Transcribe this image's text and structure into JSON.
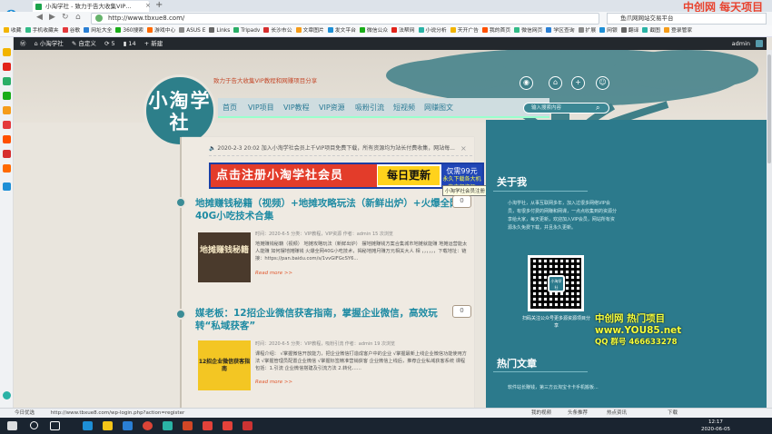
{
  "browser": {
    "tab_title": "小淘学社 - 致力于告大收集VIP…",
    "url": "http://www.tbxue8.com/",
    "search_text": "鱼爪网网站交易平台",
    "top_promo": "中创网  每天项目",
    "bookmarks": [
      "收藏",
      "手机收藏夹",
      "谷歌",
      "网址大全",
      "360搜索",
      "游戏中心",
      "ASUS E",
      "Links",
      "Tripadv",
      "长沙市公",
      "文章图片",
      "发文平台",
      "微信公众",
      "法帮网",
      "小说分析",
      "天开广告",
      "我的首页",
      "微信网页",
      "学区查询",
      "扩展",
      "网银",
      "翻译",
      "截图",
      "登录管家"
    ]
  },
  "wpbar": {
    "items": [
      "小淘学社",
      "自定义",
      "5",
      "14",
      "+ 新建"
    ],
    "user": "admin"
  },
  "site": {
    "logo_text": "小淘学社",
    "tagline": "致力于告大收集VIP教程和网赚项目分享",
    "nav": [
      "首页",
      "VIP项目",
      "VIP教程",
      "VIP资源",
      "吸粉引流",
      "短视频",
      "网赚图文"
    ],
    "search_placeholder": "输入搜索内容"
  },
  "announcement": "2020-2-3  20:02  加入小淘学社会员上千VIP项目免费下载，所有资源均为站长付费收集，网站每...",
  "banner": {
    "red": "点击注册小淘学社会员",
    "yellow": "每日更新",
    "blue_top": "仅需99元",
    "blue_bottom": "永久下载各大机构内部资源"
  },
  "tooltip": "小淘学社会员注册",
  "posts": [
    {
      "title": "地摊赚钱秘籍（视频）+地摊攻略玩法（新鲜出炉）+火爆全网40G小吃技术合集",
      "comments": "0",
      "thumb_text": "地摊赚钱秘籍",
      "meta": "时间：2020-6-5   分类：VIP教程，VIP资源   作者：admin   15 次浏览",
      "excerpt": "地摊赚钱秘籍（视频） 地摊攻略玩法（新鲜出炉） 摆地摊赚钱方案合集城市地摊就能赚 地摊运营能太人能赚 如何摆地摊赚钱 火爆全网40G小吃技术，揭秘地摊月赚万元相关大人 相 ，，，，，，下载地址：链接：https://pan.baidu.com/s/1vvGIFGcSY6...",
      "more": "Read more >>"
    },
    {
      "title": "媒老板：12招企业微信获客指南，掌握企业微信，高效玩转“私域获客”",
      "comments": "0",
      "thumb_text": "12招企业微信获客指南",
      "meta": "时间：2020-6-5   分类：VIP教程，吸粉引流   作者：admin   19 次浏览",
      "excerpt": "课程介绍： √掌握微信开放能力，把企业微信打造成客户中的企业 √掌握最新上线企业微信功能使用方法 √掌握管理员配置企业微信 √掌握标签精准营销获客 企业微信上线后，推荐企业私域获客系统 课程包括：1.引流 企业微信搭建及引流方法 2.转化……",
      "more": "Read more >>"
    }
  ],
  "sidebar": {
    "about_title": "关于我",
    "about_text": "小淘学社，从事互联网多年，加入过很多网络VIP会员，有很多付费的网赚和网课，一点点收集到的资源分享给大家，每天更新，欢迎加入VIP会员，网站所有资源永久免费下载，并且永久更新。",
    "qr_center": "小淘学社",
    "qr_caption": "扫码关注公众号更多源资源项目分享",
    "promo_lines": [
      "中创网 热门项目",
      "www.YOU85.net",
      "QQ 群号 466633278"
    ],
    "hot_title": "热门文章",
    "hot_text": "软件站长赚钱，第三方云淘宝卡卡手机搬板..."
  },
  "status_bar": {
    "left": "今日优选",
    "url": "http://www.tbxue8.com/wp-login.php?action=register",
    "right": [
      "我的视频",
      "头条推荐",
      "热点资讯",
      "下载"
    ]
  },
  "taskbar": {
    "time": "12:17",
    "date": "2020-06-05"
  }
}
